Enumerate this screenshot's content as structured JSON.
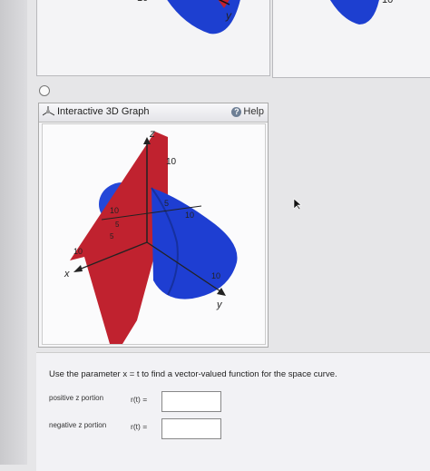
{
  "prev_left_label": "y",
  "prev_left_tick": "10",
  "prev_right_tick": "10",
  "graph": {
    "title": "Interactive 3D Graph",
    "help_label": "Help",
    "help_glyph": "?",
    "axes": {
      "z": "z",
      "x": "x",
      "y": "y",
      "ticks": [
        "10",
        "5",
        "10",
        "5",
        "10",
        "5",
        "10",
        "10"
      ]
    },
    "colors": {
      "plane": "#c2222e",
      "cylinder": "#1d3fd0"
    }
  },
  "question": {
    "instruction": "Use the parameter x = t to find a vector-valued function for the space curve.",
    "positive_label": "positive z portion",
    "negative_label": "negative z portion",
    "r_label": "r(t)  ="
  }
}
